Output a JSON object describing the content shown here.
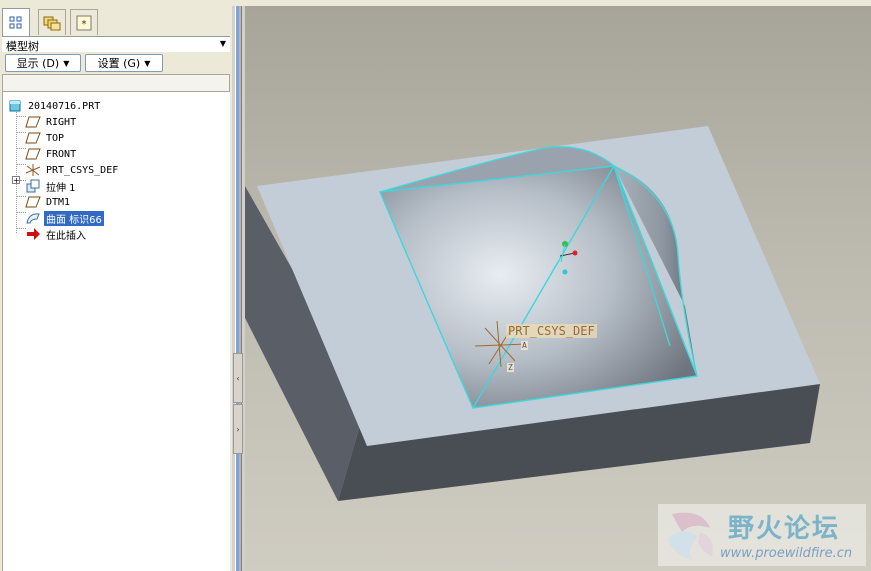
{
  "left_panel": {
    "title": "模型树",
    "buttons": {
      "show": "显示 (D)",
      "settings": "设置 (G)"
    },
    "tree": [
      {
        "label": "20140716.PRT",
        "icon": "part-icon"
      },
      {
        "label": "RIGHT",
        "icon": "datum-plane-icon"
      },
      {
        "label": "TOP",
        "icon": "datum-plane-icon"
      },
      {
        "label": "FRONT",
        "icon": "datum-plane-icon"
      },
      {
        "label": "PRT_CSYS_DEF",
        "icon": "csys-icon"
      },
      {
        "label": "拉伸 1",
        "icon": "extrude-icon"
      },
      {
        "label": "DTM1",
        "icon": "datum-plane-icon"
      },
      {
        "label": "曲面 标识66",
        "icon": "surface-icon"
      },
      {
        "label": "在此插入",
        "icon": "insert-here-arrow-icon"
      }
    ]
  },
  "viewport": {
    "csys_label": "PRT_CSYS_DEF",
    "axis_x": "A",
    "axis_z": "Z"
  },
  "watermark": {
    "title": "野火论坛",
    "url": "www.proewildfire.cn"
  },
  "colors": {
    "selection": "#316ac5",
    "edge_highlight": "#3fd6dc",
    "block_top": "#c3cdd8",
    "block_side": "#5b6068"
  }
}
